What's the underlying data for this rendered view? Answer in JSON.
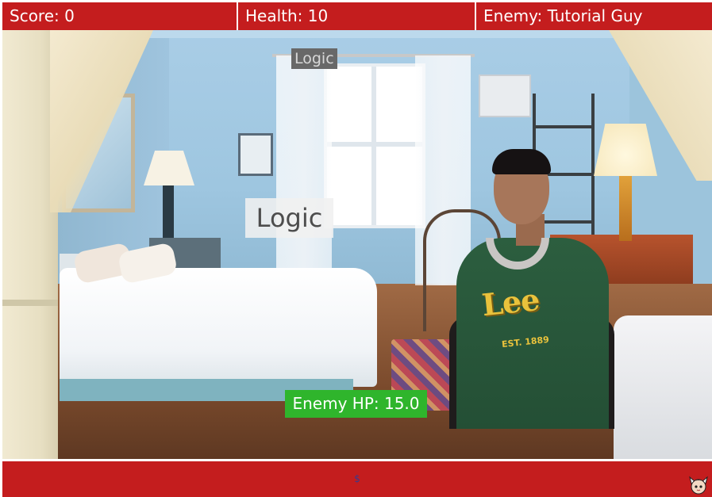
{
  "hud": {
    "score": "Score: 0",
    "health": "Health: 10",
    "enemy": "Enemy: Tutorial Guy"
  },
  "labels": {
    "logic_small": "Logic",
    "logic_big": "Logic",
    "enemy_hp": "Enemy HP: 15.0"
  },
  "shirt": {
    "logo": "Lee",
    "est": "EST. 1889"
  },
  "bottom_bar": {
    "center_text": "$"
  },
  "icons": {
    "mascot": "mascot-icon"
  },
  "colors": {
    "hud_red": "#c41d1e",
    "hp_green": "#2fb52c",
    "label_gray": "#686868"
  }
}
